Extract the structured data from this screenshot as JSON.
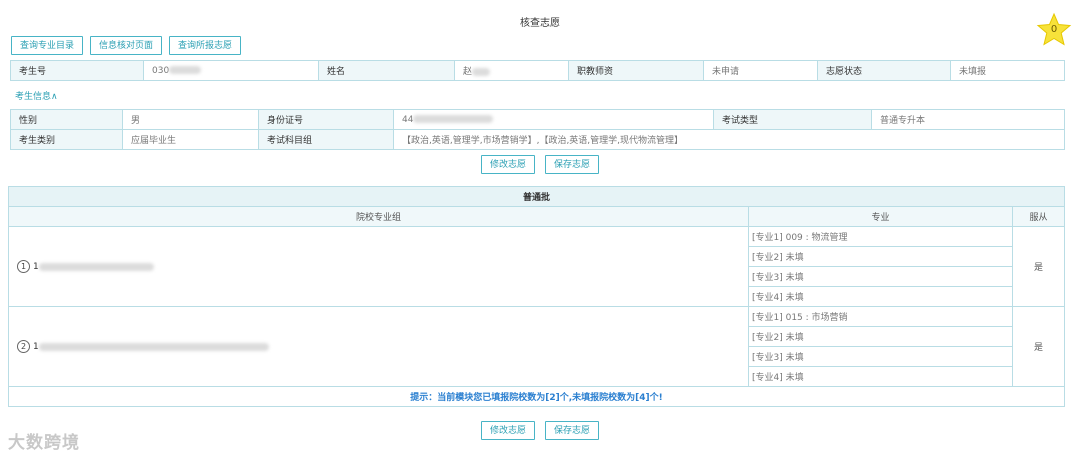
{
  "page": {
    "title": "核查志愿"
  },
  "star_badge": {
    "count": "0",
    "color": "#f7e23a"
  },
  "top_buttons": [
    "查询专业目录",
    "信息核对页面",
    "查询所报志愿"
  ],
  "header": {
    "exam_no_label": "考生号",
    "exam_no_value": "030",
    "name_label": "姓名",
    "name_value": "赵",
    "teacher_label": "职教师资",
    "teacher_value": "未申请",
    "status_label": "志愿状态",
    "status_value": "未填报"
  },
  "info_toggle": "考生信息∧",
  "info": {
    "gender_label": "性别",
    "gender_value": "男",
    "id_label": "身份证号",
    "id_value": "44",
    "type_label": "考试类型",
    "type_value": "普通专升本",
    "category_label": "考生类别",
    "category_value": "应届毕业生",
    "subjects_label": "考试科目组",
    "subjects_value": "【政治,英语,管理学,市场营销学】,【政治,英语,管理学,现代物流管理】"
  },
  "actions": {
    "modify": "修改志愿",
    "save": "保存志愿"
  },
  "batch": {
    "title": "普通批",
    "col_school": "院校专业组",
    "col_major": "专业",
    "col_obey": "服从",
    "groups": [
      {
        "num": "1",
        "code": "1",
        "majors": [
          "[专业1] 009 : 物流管理",
          "[专业2] 未填",
          "[专业3] 未填",
          "[专业4] 未填"
        ],
        "obey": "是"
      },
      {
        "num": "2",
        "code": "1",
        "majors": [
          "[专业1] 015 : 市场营销",
          "[专业2] 未填",
          "[专业3] 未填",
          "[专业4] 未填"
        ],
        "obey": "是"
      }
    ],
    "hint": "提示：当前模块您已填报院校数为[2]个,未填报院校数为[4]个!"
  },
  "watermark": "大数跨境"
}
